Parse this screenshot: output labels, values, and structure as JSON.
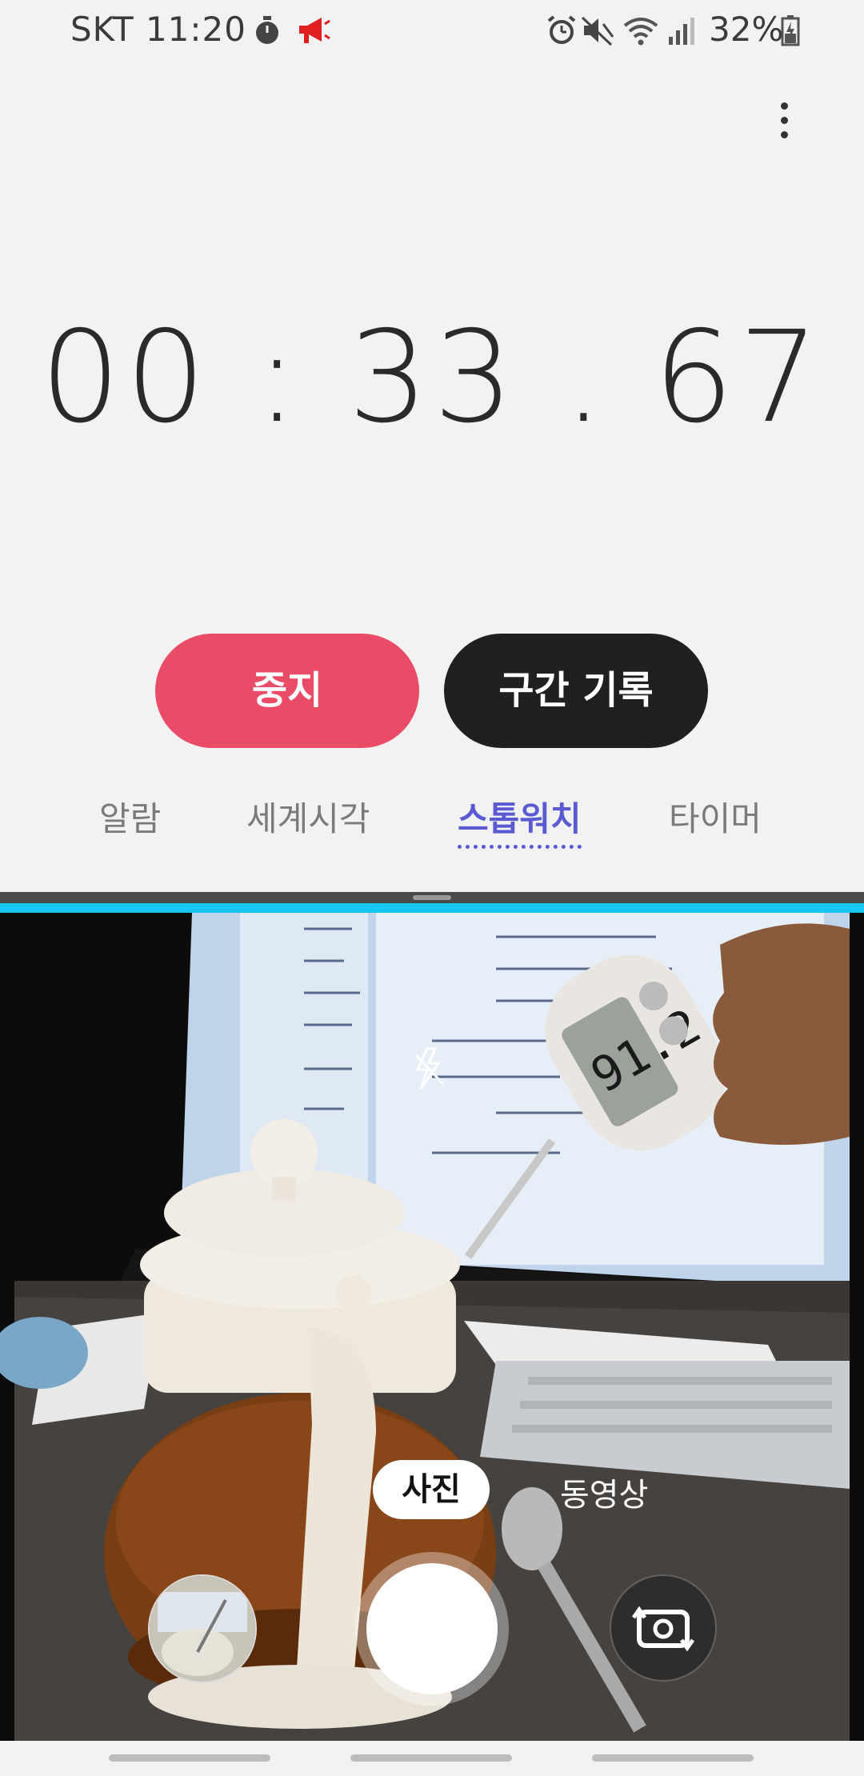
{
  "status_bar": {
    "carrier_time": "SKT 11:20",
    "battery_percent": "32%",
    "icons_left": [
      "stopwatch-icon",
      "megaphone-icon"
    ],
    "icons_right": [
      "alarm-icon",
      "mute-icon",
      "wifi-icon",
      "signal-icon",
      "battery-icon"
    ]
  },
  "stopwatch": {
    "time_display": "00 : 33 . 67",
    "stop_label": "중지",
    "lap_label": "구간 기록"
  },
  "tabs": [
    {
      "label": "알람",
      "active": false
    },
    {
      "label": "세계시각",
      "active": false
    },
    {
      "label": "스톱워치",
      "active": true
    },
    {
      "label": "타이머",
      "active": false
    }
  ],
  "camera": {
    "mode_photo": "사진",
    "mode_video": "동영상"
  },
  "colors": {
    "stop_button": "#ea4c67",
    "lap_button": "#202020",
    "active_tab": "#5a5ad2",
    "split_bar": "#17c6f0"
  }
}
